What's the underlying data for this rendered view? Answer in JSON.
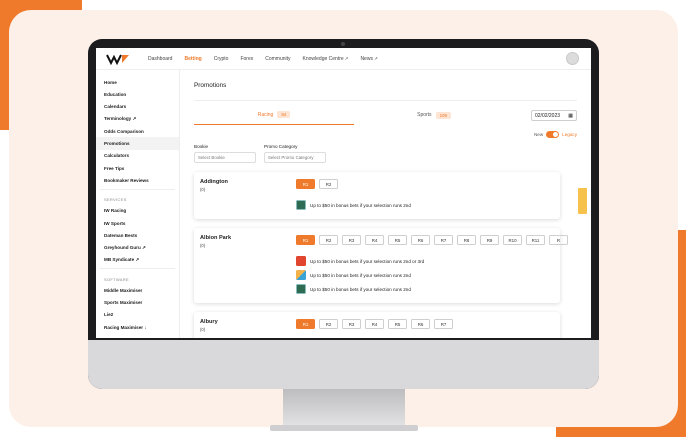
{
  "colors": {
    "accent": "#f07a2b",
    "card_bg": "#fdf0e8",
    "monitor": "#1c1c1e"
  },
  "nav": {
    "items": [
      {
        "label": "Dashboard",
        "active": false,
        "external": false
      },
      {
        "label": "Betting",
        "active": true,
        "external": false
      },
      {
        "label": "Crypto",
        "active": false,
        "external": false
      },
      {
        "label": "Forex",
        "active": false,
        "external": false
      },
      {
        "label": "Community",
        "active": false,
        "external": false
      },
      {
        "label": "Knowledge Centre",
        "active": false,
        "external": true
      },
      {
        "label": "News",
        "active": false,
        "external": true
      }
    ]
  },
  "sidebar": {
    "items": [
      {
        "label": "Home"
      },
      {
        "label": "Education"
      },
      {
        "label": "Calendars"
      },
      {
        "label": "Terminology ↗"
      },
      {
        "label": "Odds Comparison"
      },
      {
        "label": "Promotions"
      },
      {
        "label": "Calculators"
      },
      {
        "label": "Free Tips"
      },
      {
        "label": "Bookmaker Reviews"
      }
    ],
    "services_heading": "SERVICES",
    "services": [
      {
        "label": "IW Racing"
      },
      {
        "label": "IW Sports"
      },
      {
        "label": "Dateman Bests"
      },
      {
        "label": "Greyhound Guru ↗"
      },
      {
        "label": "MB Syndicate ↗"
      }
    ],
    "software_heading": "SOFTWARE",
    "software": [
      {
        "label": "Middle Maximiser"
      },
      {
        "label": "Sports Maximiser"
      },
      {
        "label": "Lie2"
      },
      {
        "label": "Racing Maximiser ↓"
      }
    ]
  },
  "main": {
    "title": "Promotions",
    "tabs": [
      {
        "label": "Racing",
        "count": "84",
        "active": true
      },
      {
        "label": "Sports",
        "count": "109",
        "active": false
      }
    ],
    "date": "02/02/2023",
    "toggle": {
      "left": "New",
      "right": "Legacy"
    },
    "filters": [
      {
        "label": "Bookie",
        "placeholder": "Select Bookie"
      },
      {
        "label": "Promo Category",
        "placeholder": "Select Promo Category"
      }
    ],
    "venues": [
      {
        "name": "Addington",
        "count": "(0)",
        "races": [
          "R1",
          "R2"
        ],
        "promos": [
          {
            "bookie": "green",
            "text": "Up to $50 in bonus bets if your selection runs 2nd"
          }
        ]
      },
      {
        "name": "Albion Park",
        "count": "(0)",
        "races": [
          "R1",
          "R2",
          "R3",
          "R4",
          "R5",
          "R6",
          "R7",
          "R8",
          "R9",
          "R10",
          "R11",
          "R"
        ],
        "promos": [
          {
            "bookie": "red",
            "text": "Up to $50 in bonus bets if your selection runs 2nd or 3rd"
          },
          {
            "bookie": "pattern",
            "text": "Up to $50 in bonus bets if your selection runs 2nd"
          },
          {
            "bookie": "green",
            "text": "Up to $50 in bonus bets if your selection runs 2nd"
          }
        ]
      },
      {
        "name": "Albury",
        "count": "(0)",
        "races": [
          "R1",
          "R2",
          "R3",
          "R4",
          "R5",
          "R6",
          "R7"
        ],
        "promos": []
      }
    ]
  }
}
